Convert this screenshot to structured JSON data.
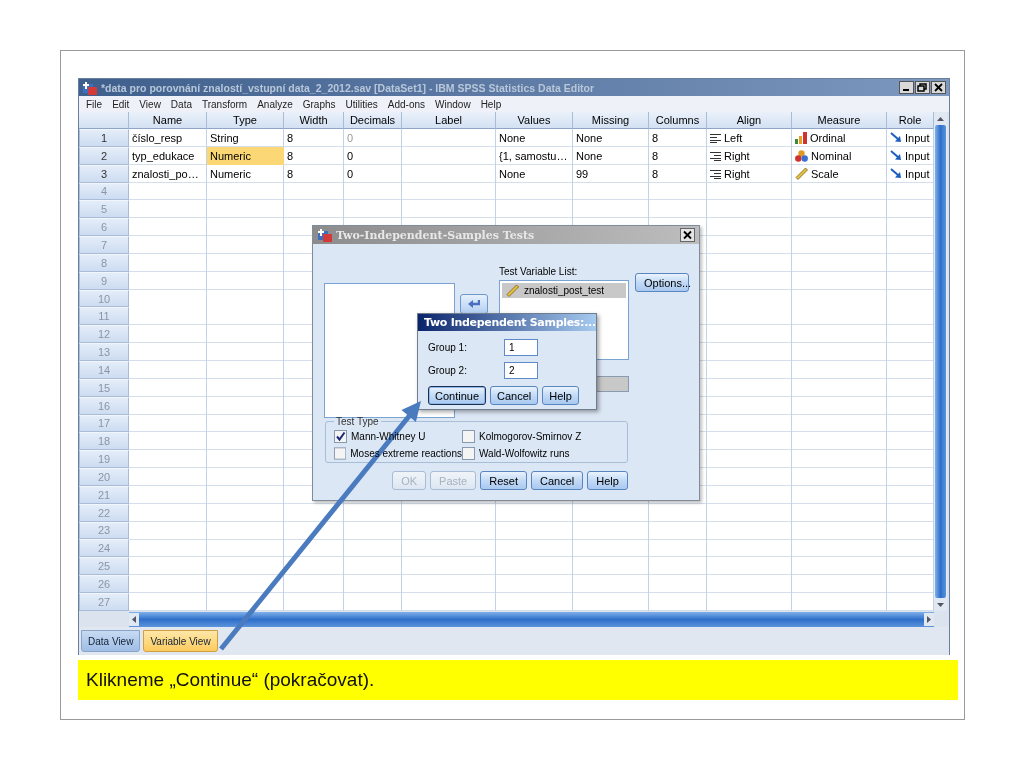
{
  "window": {
    "title": "*data pro porovnání znalostí_vstupní data_2_2012.sav [DataSet1] - IBM SPSS Statistics Data Editor",
    "active": false
  },
  "menu": [
    "File",
    "Edit",
    "View",
    "Data",
    "Transform",
    "Analyze",
    "Graphs",
    "Utilities",
    "Add-ons",
    "Window",
    "Help"
  ],
  "grid": {
    "columns": [
      "Name",
      "Type",
      "Width",
      "Decimals",
      "Label",
      "Values",
      "Missing",
      "Columns",
      "Align",
      "Measure",
      "Role"
    ],
    "rows": [
      {
        "number": "1",
        "cells": [
          {
            "kind": "text",
            "text": "číslo_resp",
            "selected": false
          },
          {
            "kind": "text",
            "text": "String",
            "selected": false
          },
          {
            "kind": "text",
            "text": "8",
            "selected": false
          },
          {
            "kind": "muted",
            "text": "0",
            "selected": false
          },
          {
            "kind": "text",
            "selected": false
          },
          {
            "kind": "text",
            "text": "None",
            "selected": false
          },
          {
            "kind": "text",
            "text": "None",
            "selected": false
          },
          {
            "kind": "text",
            "text": "8",
            "selected": false
          },
          {
            "kind": "align-left",
            "text": "Left",
            "selected": false
          },
          {
            "kind": "ordinal",
            "text": "Ordinal",
            "selected": false
          },
          {
            "kind": "input",
            "text": "Input",
            "selected": false
          }
        ]
      },
      {
        "number": "2",
        "cells": [
          {
            "kind": "text",
            "text": "typ_edukace",
            "selected": false
          },
          {
            "kind": "text",
            "text": "Numeric",
            "selected": true
          },
          {
            "kind": "text",
            "text": "8",
            "selected": false
          },
          {
            "kind": "text",
            "text": "0",
            "selected": false
          },
          {
            "kind": "text",
            "selected": false
          },
          {
            "kind": "text",
            "text": "{1, samostu…",
            "selected": false
          },
          {
            "kind": "text",
            "text": "None",
            "selected": false
          },
          {
            "kind": "text",
            "text": "8",
            "selected": false
          },
          {
            "kind": "align-right",
            "text": "Right",
            "selected": false
          },
          {
            "kind": "nominal",
            "text": "Nominal",
            "selected": false
          },
          {
            "kind": "input",
            "text": "Input",
            "selected": false
          }
        ]
      },
      {
        "number": "3",
        "cells": [
          {
            "kind": "text",
            "text": "znalosti_po…",
            "selected": false
          },
          {
            "kind": "text",
            "text": "Numeric",
            "selected": false
          },
          {
            "kind": "text",
            "text": "8",
            "selected": false
          },
          {
            "kind": "text",
            "text": "0",
            "selected": false
          },
          {
            "kind": "text",
            "selected": false
          },
          {
            "kind": "text",
            "text": "None",
            "selected": false
          },
          {
            "kind": "text",
            "text": "99",
            "selected": false
          },
          {
            "kind": "text",
            "text": "8",
            "selected": false
          },
          {
            "kind": "align-right",
            "text": "Right",
            "selected": false
          },
          {
            "kind": "scale",
            "text": "Scale",
            "selected": false
          },
          {
            "kind": "input",
            "text": "Input",
            "selected": false
          }
        ]
      },
      {
        "number": "4"
      },
      {
        "number": "5"
      },
      {
        "number": "6"
      },
      {
        "number": "7"
      },
      {
        "number": "8"
      },
      {
        "number": "9"
      },
      {
        "number": "10"
      },
      {
        "number": "11"
      },
      {
        "number": "12"
      },
      {
        "number": "13"
      },
      {
        "number": "14"
      },
      {
        "number": "15"
      },
      {
        "number": "16"
      },
      {
        "number": "17"
      },
      {
        "number": "18"
      },
      {
        "number": "19"
      },
      {
        "number": "20"
      },
      {
        "number": "21"
      },
      {
        "number": "22"
      },
      {
        "number": "23"
      },
      {
        "number": "24"
      },
      {
        "number": "25"
      },
      {
        "number": "26"
      },
      {
        "number": "27"
      }
    ]
  },
  "view_tabs": [
    {
      "label": "Data View",
      "selected": false
    },
    {
      "label": "Variable View",
      "selected": true
    }
  ],
  "tests_dialog": {
    "title": "Two-Independent-Samples Tests",
    "active": false,
    "list_label": "Test Variable List:",
    "test_variables": [
      {
        "name": "znalosti_post_test",
        "selected": true
      }
    ],
    "options_button": "Options...",
    "test_type": {
      "legend": "Test Type",
      "options": [
        {
          "label": "Mann-Whitney U",
          "checked": true
        },
        {
          "label": "Kolmogorov-Smirnov Z",
          "checked": false
        },
        {
          "label": "Moses extreme reactions",
          "checked": false
        },
        {
          "label": "Wald-Wolfowitz runs",
          "checked": false
        }
      ]
    },
    "buttons": [
      {
        "label": "OK",
        "disabled": true
      },
      {
        "label": "Paste",
        "disabled": true
      },
      {
        "label": "Reset",
        "disabled": false
      },
      {
        "label": "Cancel",
        "disabled": false
      },
      {
        "label": "Help",
        "disabled": false
      }
    ]
  },
  "groups_dialog": {
    "title": "Two Independent Samples:...",
    "active": true,
    "fields": [
      {
        "label": "Group 1:",
        "value": "1"
      },
      {
        "label": "Group 2:",
        "value": "2"
      }
    ],
    "buttons": [
      {
        "label": "Continue",
        "focused": true
      },
      {
        "label": "Cancel",
        "focused": false
      },
      {
        "label": "Help",
        "focused": false
      }
    ]
  },
  "caption": "Klikneme „Continue“ (pokračovat)."
}
